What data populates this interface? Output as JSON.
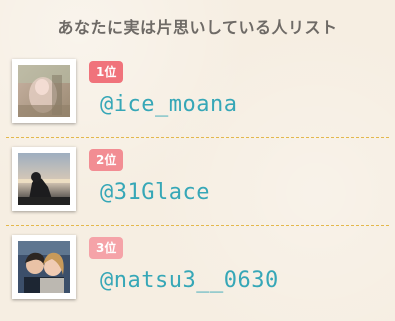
{
  "header": {
    "title": "あなたに実は片思いしている人リスト"
  },
  "colors": {
    "rank_1": "#f0737b",
    "rank_2": "#f28d93",
    "rank_3": "#f5a3a8",
    "handle": "#36a7b7",
    "divider": "#e3b84c"
  },
  "ranking": [
    {
      "rank": "1位",
      "handle": "@ice_moana",
      "image": "profile-photo-ice-moana"
    },
    {
      "rank": "2位",
      "handle": "@31Glace",
      "image": "profile-photo-31glace"
    },
    {
      "rank": "3位",
      "handle": "@natsu3__0630",
      "image": "profile-photo-natsu3-0630"
    }
  ]
}
